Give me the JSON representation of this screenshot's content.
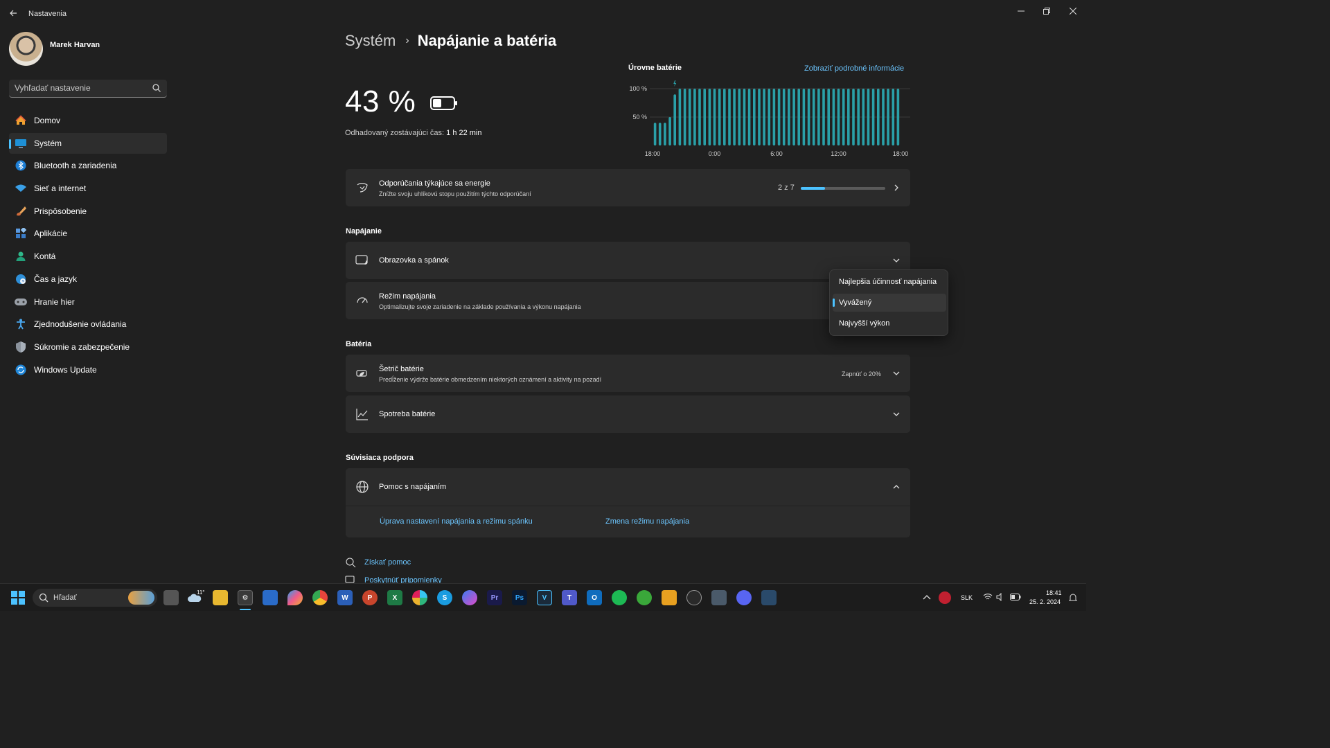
{
  "window": {
    "app_title": "Nastavenia",
    "back": "←",
    "minimize": "─",
    "maximize": "❐",
    "close": "✕"
  },
  "user": {
    "name": "Marek Harvan"
  },
  "search": {
    "placeholder": "Vyhľadať nastavenie"
  },
  "sidebar": {
    "items": [
      {
        "label": "Domov",
        "icon": "home-icon",
        "active": false
      },
      {
        "label": "Systém",
        "icon": "system-monitor-icon",
        "active": true
      },
      {
        "label": "Bluetooth a zariadenia",
        "icon": "bluetooth-icon",
        "active": false
      },
      {
        "label": "Sieť a internet",
        "icon": "wifi-icon",
        "active": false
      },
      {
        "label": "Prispôsobenie",
        "icon": "paintbrush-icon",
        "active": false
      },
      {
        "label": "Aplikácie",
        "icon": "apps-icon",
        "active": false
      },
      {
        "label": "Kontá",
        "icon": "person-icon",
        "active": false
      },
      {
        "label": "Čas a jazyk",
        "icon": "globe-clock-icon",
        "active": false
      },
      {
        "label": "Hranie hier",
        "icon": "gamepad-icon",
        "active": false
      },
      {
        "label": "Zjednodušenie ovládania",
        "icon": "accessibility-icon",
        "active": false
      },
      {
        "label": "Súkromie a zabezpečenie",
        "icon": "shield-icon",
        "active": false
      },
      {
        "label": "Windows Update",
        "icon": "update-icon",
        "active": false
      }
    ]
  },
  "breadcrumb": {
    "parent": "Systém",
    "separator": "›",
    "current": "Napájanie a batéria"
  },
  "battery": {
    "percent": "43 %",
    "level": 0.43,
    "remaining_label": "Odhadovaný zostávajúci čas:",
    "remaining_value": "1 h 22 min"
  },
  "chart_data": {
    "type": "bar",
    "title": "Úrovne batérie",
    "link": "Zobraziť podrobné informácie",
    "y_ticks": [
      "100 %",
      "50 %"
    ],
    "x_ticks": [
      "18:00",
      "0:00",
      "6:00",
      "12:00",
      "18:00"
    ],
    "ylim": [
      0,
      100
    ],
    "values": [
      40,
      40,
      40,
      50,
      90,
      100,
      100,
      100,
      100,
      100,
      100,
      100,
      100,
      100,
      100,
      100,
      100,
      100,
      100,
      100,
      100,
      100,
      100,
      100,
      100,
      100,
      100,
      100,
      100,
      100,
      100,
      100,
      100,
      100,
      100,
      100,
      100,
      100,
      100,
      100,
      100,
      100,
      100,
      100,
      100,
      100,
      100,
      100,
      100,
      100
    ],
    "color": "#2aa0a8"
  },
  "energy_card": {
    "title": "Odporúčania týkajúce sa energie",
    "subtitle": "Znížte svoju uhlíkovú stopu použitím týchto odporúčaní",
    "progress_text": "2 z 7",
    "progress": 0.2857
  },
  "sections": {
    "power": "Napájanie",
    "battery": "Batéria",
    "support": "Súvisiaca podpora"
  },
  "power": {
    "screen_sleep": "Obrazovka a spánok",
    "power_mode_title": "Režim napájania",
    "power_mode_subtitle": "Optimalizujte svoje zariadenie na základe používania a výkonu napájania"
  },
  "power_mode_menu": {
    "options": [
      "Najlepšia účinnosť napájania",
      "Vyvážený",
      "Najvyšší výkon"
    ],
    "selected": "Vyvážený"
  },
  "battery_section": {
    "saver_title": "Šetrič batérie",
    "saver_subtitle": "Predĺženie výdrže batérie obmedzením niektorých oznámení a aktivity na pozadí",
    "saver_value": "Zapnúť o 20%",
    "usage_title": "Spotreba batérie"
  },
  "support": {
    "help_title": "Pomoc s napájaním",
    "link1": "Úprava nastavení napájania a režimu spánku",
    "link2": "Zmena režimu napájania"
  },
  "footer": {
    "get_help": "Získať pomoc",
    "feedback": "Poskytnúť pripomienky"
  },
  "taskbar": {
    "search_label": "Hľadať",
    "weather": "11°",
    "apps": [
      "windows-start-icon",
      "search-icon",
      "weather-icon",
      "file-explorer-icon",
      "settings-icon",
      "store-icon",
      "paint-icon",
      "chrome-icon",
      "word-icon",
      "powerpoint-icon",
      "excel-icon",
      "slack-icon",
      "skype-icon",
      "messenger-icon",
      "premiere-icon",
      "photoshop-icon",
      "visual-studio-icon",
      "teams-icon",
      "outlook-icon",
      "spotify-icon",
      "xbox-icon",
      "layers-icon",
      "obs-icon",
      "calculator-icon",
      "discord-icon",
      "task-manager-icon"
    ],
    "tray": {
      "language": "SLK",
      "time": "18:41",
      "date": "25. 2. 2024"
    }
  }
}
